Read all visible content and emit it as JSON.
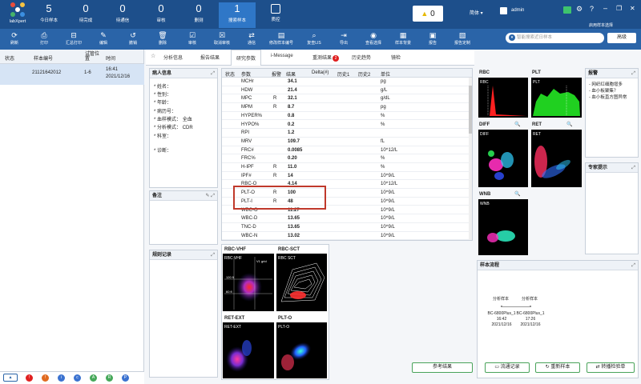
{
  "app": {
    "name": "labXpert"
  },
  "stats": [
    {
      "num": "5",
      "label": "今日样本"
    },
    {
      "num": "0",
      "label": "待完成"
    },
    {
      "num": "0",
      "label": "待通信"
    },
    {
      "num": "0",
      "label": "审核"
    },
    {
      "num": "0",
      "label": "删测"
    },
    {
      "num": "1",
      "label": "搜索样本"
    }
  ],
  "top_extra": {
    "label": "质控"
  },
  "warning_count": "0",
  "user": {
    "lang": "简体",
    "name": "admin"
  },
  "toolbar_right_label": "启用样本选择",
  "toolbar": [
    "刷新",
    "打印",
    "汇总打印",
    "编辑",
    "撤销",
    "删除",
    "审核",
    "取消审核",
    "通信",
    "修改样本编号",
    "复查LIS",
    "导出",
    "查看选择",
    "样本背景",
    "报告",
    "报告定制"
  ],
  "search": {
    "placeholder": "智能搜索近日样本",
    "advanced": "高级"
  },
  "sample_list": {
    "headers": [
      "状态",
      "样本编号",
      "试管位置",
      "时间"
    ],
    "rows": [
      {
        "id": "21121642012",
        "pos": "1-6",
        "time": "16:41",
        "date": "2021/12/16"
      }
    ]
  },
  "tabs": [
    "分析信息",
    "报告结果",
    "研究参数",
    "i-Message",
    "重测结果",
    "历史趋势",
    "镜检"
  ],
  "retest_badge": "2",
  "patient": {
    "title": "病人信息",
    "fields": [
      {
        "label": "* 姓名：",
        "value": ""
      },
      {
        "label": "* 性别：",
        "value": ""
      },
      {
        "label": "* 年龄：",
        "value": ""
      },
      {
        "label": "* 病历号：",
        "value": ""
      },
      {
        "label": "* 血样模式：",
        "value": "全血"
      },
      {
        "label": "* 分析模式：",
        "value": "CDR"
      },
      {
        "label": "* 科室：",
        "value": ""
      },
      {
        "label": "* 诊断：",
        "value": ""
      }
    ]
  },
  "remark_title": "备注",
  "rule_title": "规则记录",
  "table": {
    "headers": [
      "状态",
      "参数",
      "报警",
      "结果",
      "Delta(#)",
      "历史1",
      "历史2",
      "单位"
    ],
    "rows": [
      {
        "param": "MCHr",
        "flag": "",
        "value": "34.1",
        "unit": "pg"
      },
      {
        "param": "HDW",
        "flag": "",
        "value": "21.4",
        "unit": "g/L"
      },
      {
        "param": "MPC",
        "flag": "R",
        "value": "32.1",
        "unit": "g/dL"
      },
      {
        "param": "MPM",
        "flag": "R",
        "value": "8.7",
        "unit": "pg"
      },
      {
        "param": "HYPER%",
        "flag": "",
        "value": "0.8",
        "unit": "%"
      },
      {
        "param": "HYPO%",
        "flag": "",
        "value": "0.2",
        "unit": "%"
      },
      {
        "param": "RPI",
        "flag": "",
        "value": "1.2",
        "unit": ""
      },
      {
        "param": "MRV",
        "flag": "",
        "value": "109.7",
        "unit": "fL"
      },
      {
        "param": "FRC#",
        "flag": "",
        "value": "0.0085",
        "unit": "10^12/L"
      },
      {
        "param": "FRC%",
        "flag": "",
        "value": "0.20",
        "unit": "%"
      },
      {
        "param": "H-IPF",
        "flag": "R",
        "value": "11.0",
        "unit": "%"
      },
      {
        "param": "IPF#",
        "flag": "R",
        "value": "14",
        "unit": "10^9/L"
      },
      {
        "param": "RBC-O",
        "flag": "",
        "value": "4.14",
        "unit": "10^12/L"
      },
      {
        "param": "PLT-O",
        "flag": "R",
        "value": "100",
        "unit": "10^9/L"
      },
      {
        "param": "PLT-I",
        "flag": "R",
        "value": "48",
        "unit": "10^9/L"
      },
      {
        "param": "WBC-O",
        "flag": "",
        "value": "11.27",
        "unit": "10^9/L"
      },
      {
        "param": "WBC-D",
        "flag": "",
        "value": "13.65",
        "unit": "10^9/L"
      },
      {
        "param": "TNC-D",
        "flag": "",
        "value": "13.65",
        "unit": "10^9/L"
      },
      {
        "param": "WBC-N",
        "flag": "",
        "value": "13.02",
        "unit": "10^9/L"
      }
    ]
  },
  "plots_mid": [
    {
      "title": "RBC-VHF",
      "inner": "RBC VHF"
    },
    {
      "title": "RBC-SCT",
      "inner": "RBC SCT"
    },
    {
      "title": "RET-EXT",
      "inner": "RET-EXT"
    },
    {
      "title": "PLT-O",
      "inner": "PLT-O"
    }
  ],
  "vhf_labels": {
    "top": "V1 grid",
    "left": "120 fl",
    "left2": "60 fl"
  },
  "plots_right": [
    {
      "title": "RBC",
      "inner": "RBC"
    },
    {
      "title": "PLT",
      "inner": "PLT"
    },
    {
      "title": "DIFF",
      "inner": "DIFF"
    },
    {
      "title": "RET",
      "inner": "RET"
    },
    {
      "title": "WNB",
      "inner": "WNB"
    }
  ],
  "alarm": {
    "title": "报警",
    "items": [
      "- 网织红细胞增多",
      "- 血小板聚集？",
      "- 血小板直方图异常"
    ]
  },
  "expert_title": "专家提示",
  "process": {
    "title": "样本流程",
    "steps": [
      {
        "label": "分析样本",
        "device": "BC-6800Plus_1",
        "time": "16:42",
        "date": "2021/12/16"
      },
      {
        "label": "分析样本",
        "device": "BC-6800Plus_1",
        "time": "17:26",
        "date": "2021/12/16"
      }
    ]
  },
  "buttons": {
    "ref": "参考结果",
    "flow": "流通记录",
    "retest": "重新样本",
    "transfer": "转播检验单"
  },
  "colors": {
    "topbar": "#1d4f8b",
    "toolbar": "#2a64a8",
    "active": "#2f77c7",
    "highlight": "#c0392b"
  }
}
